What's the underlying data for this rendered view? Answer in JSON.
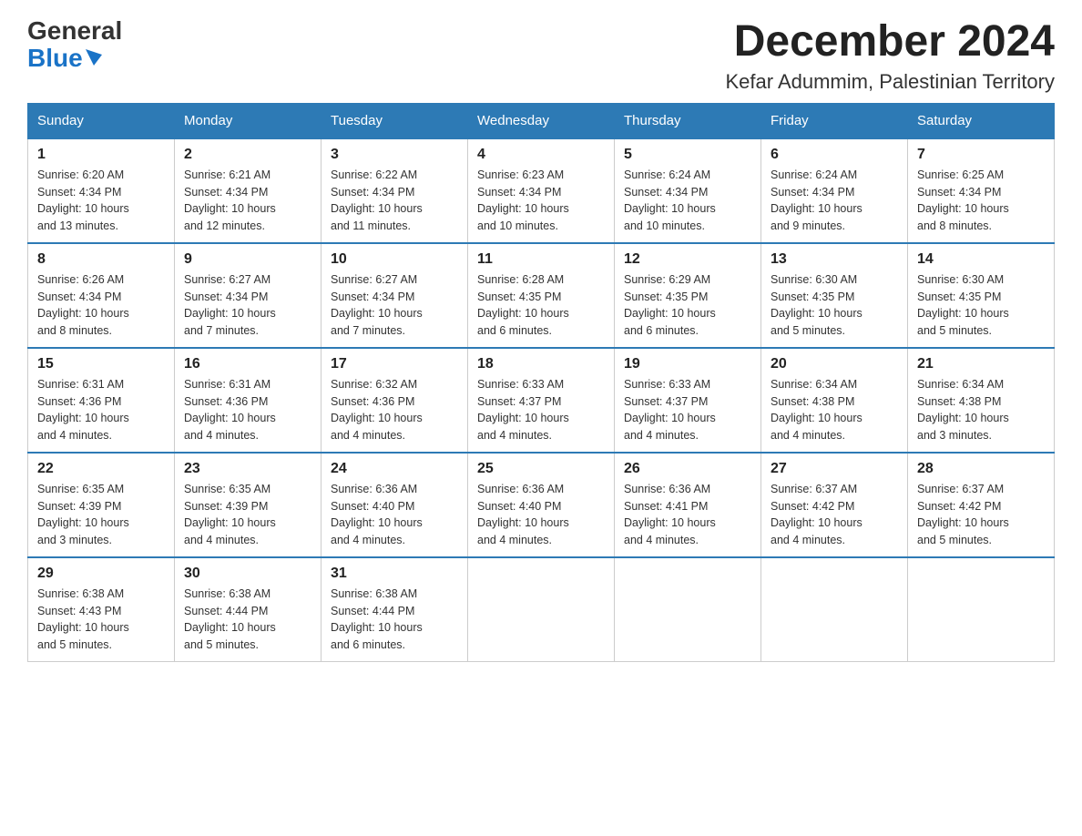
{
  "header": {
    "logo_general": "General",
    "logo_blue": "Blue",
    "month_title": "December 2024",
    "location": "Kefar Adummim, Palestinian Territory"
  },
  "weekdays": [
    "Sunday",
    "Monday",
    "Tuesday",
    "Wednesday",
    "Thursday",
    "Friday",
    "Saturday"
  ],
  "weeks": [
    [
      {
        "day": "1",
        "sunrise": "6:20 AM",
        "sunset": "4:34 PM",
        "daylight": "10 hours and 13 minutes."
      },
      {
        "day": "2",
        "sunrise": "6:21 AM",
        "sunset": "4:34 PM",
        "daylight": "10 hours and 12 minutes."
      },
      {
        "day": "3",
        "sunrise": "6:22 AM",
        "sunset": "4:34 PM",
        "daylight": "10 hours and 11 minutes."
      },
      {
        "day": "4",
        "sunrise": "6:23 AM",
        "sunset": "4:34 PM",
        "daylight": "10 hours and 10 minutes."
      },
      {
        "day": "5",
        "sunrise": "6:24 AM",
        "sunset": "4:34 PM",
        "daylight": "10 hours and 10 minutes."
      },
      {
        "day": "6",
        "sunrise": "6:24 AM",
        "sunset": "4:34 PM",
        "daylight": "10 hours and 9 minutes."
      },
      {
        "day": "7",
        "sunrise": "6:25 AM",
        "sunset": "4:34 PM",
        "daylight": "10 hours and 8 minutes."
      }
    ],
    [
      {
        "day": "8",
        "sunrise": "6:26 AM",
        "sunset": "4:34 PM",
        "daylight": "10 hours and 8 minutes."
      },
      {
        "day": "9",
        "sunrise": "6:27 AM",
        "sunset": "4:34 PM",
        "daylight": "10 hours and 7 minutes."
      },
      {
        "day": "10",
        "sunrise": "6:27 AM",
        "sunset": "4:34 PM",
        "daylight": "10 hours and 7 minutes."
      },
      {
        "day": "11",
        "sunrise": "6:28 AM",
        "sunset": "4:35 PM",
        "daylight": "10 hours and 6 minutes."
      },
      {
        "day": "12",
        "sunrise": "6:29 AM",
        "sunset": "4:35 PM",
        "daylight": "10 hours and 6 minutes."
      },
      {
        "day": "13",
        "sunrise": "6:30 AM",
        "sunset": "4:35 PM",
        "daylight": "10 hours and 5 minutes."
      },
      {
        "day": "14",
        "sunrise": "6:30 AM",
        "sunset": "4:35 PM",
        "daylight": "10 hours and 5 minutes."
      }
    ],
    [
      {
        "day": "15",
        "sunrise": "6:31 AM",
        "sunset": "4:36 PM",
        "daylight": "10 hours and 4 minutes."
      },
      {
        "day": "16",
        "sunrise": "6:31 AM",
        "sunset": "4:36 PM",
        "daylight": "10 hours and 4 minutes."
      },
      {
        "day": "17",
        "sunrise": "6:32 AM",
        "sunset": "4:36 PM",
        "daylight": "10 hours and 4 minutes."
      },
      {
        "day": "18",
        "sunrise": "6:33 AM",
        "sunset": "4:37 PM",
        "daylight": "10 hours and 4 minutes."
      },
      {
        "day": "19",
        "sunrise": "6:33 AM",
        "sunset": "4:37 PM",
        "daylight": "10 hours and 4 minutes."
      },
      {
        "day": "20",
        "sunrise": "6:34 AM",
        "sunset": "4:38 PM",
        "daylight": "10 hours and 4 minutes."
      },
      {
        "day": "21",
        "sunrise": "6:34 AM",
        "sunset": "4:38 PM",
        "daylight": "10 hours and 3 minutes."
      }
    ],
    [
      {
        "day": "22",
        "sunrise": "6:35 AM",
        "sunset": "4:39 PM",
        "daylight": "10 hours and 3 minutes."
      },
      {
        "day": "23",
        "sunrise": "6:35 AM",
        "sunset": "4:39 PM",
        "daylight": "10 hours and 4 minutes."
      },
      {
        "day": "24",
        "sunrise": "6:36 AM",
        "sunset": "4:40 PM",
        "daylight": "10 hours and 4 minutes."
      },
      {
        "day": "25",
        "sunrise": "6:36 AM",
        "sunset": "4:40 PM",
        "daylight": "10 hours and 4 minutes."
      },
      {
        "day": "26",
        "sunrise": "6:36 AM",
        "sunset": "4:41 PM",
        "daylight": "10 hours and 4 minutes."
      },
      {
        "day": "27",
        "sunrise": "6:37 AM",
        "sunset": "4:42 PM",
        "daylight": "10 hours and 4 minutes."
      },
      {
        "day": "28",
        "sunrise": "6:37 AM",
        "sunset": "4:42 PM",
        "daylight": "10 hours and 5 minutes."
      }
    ],
    [
      {
        "day": "29",
        "sunrise": "6:38 AM",
        "sunset": "4:43 PM",
        "daylight": "10 hours and 5 minutes."
      },
      {
        "day": "30",
        "sunrise": "6:38 AM",
        "sunset": "4:44 PM",
        "daylight": "10 hours and 5 minutes."
      },
      {
        "day": "31",
        "sunrise": "6:38 AM",
        "sunset": "4:44 PM",
        "daylight": "10 hours and 6 minutes."
      },
      null,
      null,
      null,
      null
    ]
  ],
  "labels": {
    "sunrise_prefix": "Sunrise: ",
    "sunset_prefix": "Sunset: ",
    "daylight_prefix": "Daylight: "
  }
}
